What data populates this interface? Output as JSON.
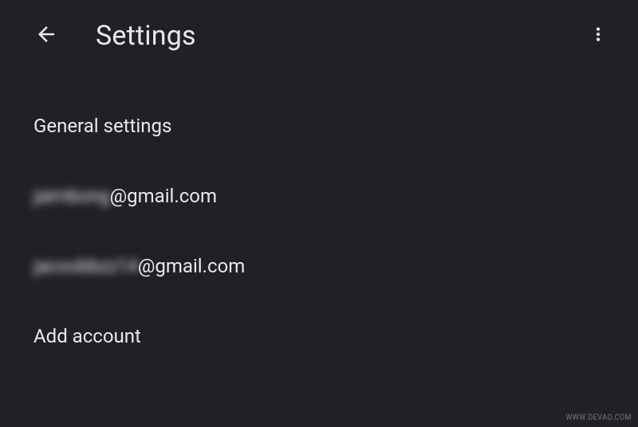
{
  "header": {
    "title": "Settings"
  },
  "list": {
    "general_settings_label": "General settings",
    "add_account_label": "Add account"
  },
  "accounts": [
    {
      "username_obscured": "jaimbong",
      "domain": "@gmail.com"
    },
    {
      "username_obscured": "jacoobbzz14",
      "domain": "@gmail.com"
    }
  ],
  "watermark": "WWW.DEVAO.COM"
}
